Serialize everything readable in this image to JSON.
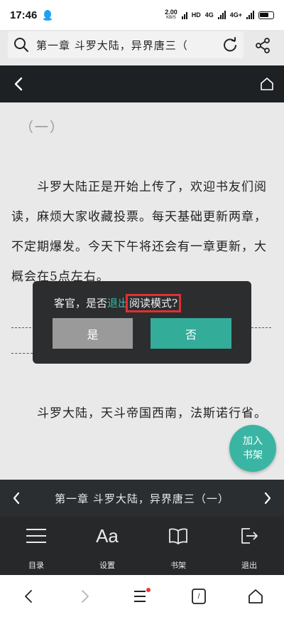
{
  "status_bar": {
    "time": "17:46",
    "net_speed": "2.00",
    "net_speed_unit": "KB/S",
    "hd": "HD",
    "net_1": "4G",
    "net_2": "4G+"
  },
  "search_bar": {
    "title": "第一章 斗罗大陆，异界唐三（"
  },
  "content": {
    "section_mark": "（一）",
    "paragraph_1": "斗罗大陆正是开始上传了，欢迎书友们阅读，麻烦大家收藏投票。每天基础更新两章，不定期爆发。今天下午将还会有一章更新，大概会在5点左右。",
    "paragraph_2": "斗罗大陆，天斗帝国西南，法斯诺行省。"
  },
  "dialog": {
    "text_before": "客官，是否",
    "text_link": "退出",
    "text_highlight": "阅读模式?",
    "yes_label": "是",
    "no_label": "否"
  },
  "fab": {
    "line1": "加入",
    "line2": "书架"
  },
  "chapter_nav": {
    "title": "第一章 斗罗大陆，异界唐三（一）"
  },
  "toolbar": {
    "catalog_label": "目录",
    "settings_icon_text": "Aa",
    "settings_label": "设置",
    "bookshelf_label": "书架",
    "exit_label": "退出"
  },
  "browser_bar": {
    "tabs_count": "/"
  },
  "colors": {
    "accent": "#33ac9a",
    "highlight_box": "#e03030",
    "dark_panel": "#2c2d2f",
    "page_bg": "#e9e9e9"
  }
}
